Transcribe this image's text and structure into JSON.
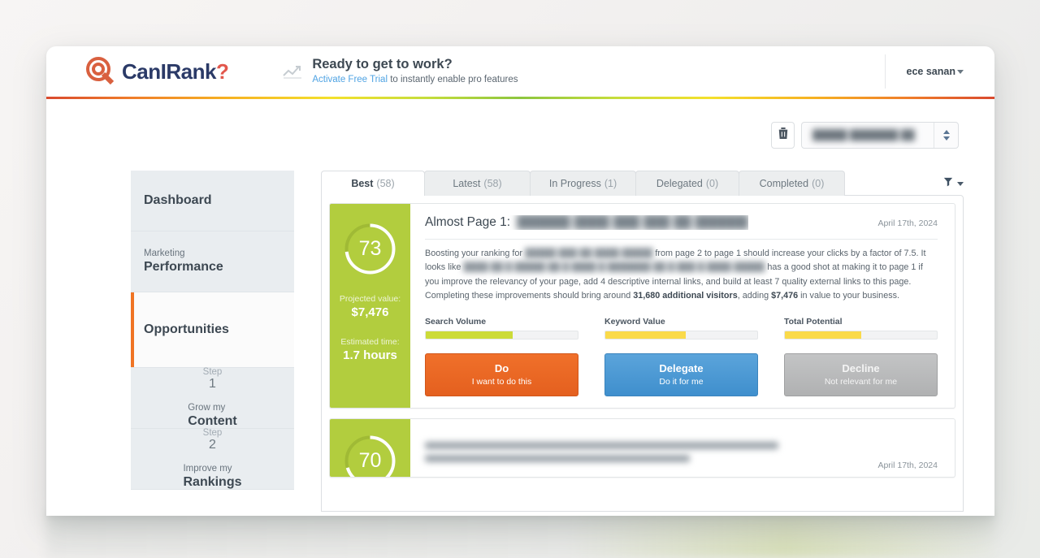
{
  "header": {
    "logo_text_1": "Can",
    "logo_text_2": "I",
    "logo_text_3": "Rank",
    "logo_text_4": "?",
    "logo_icon": "magnifier-logo-icon",
    "promo_icon": "trend-chart-icon",
    "promo_title": "Ready to get to work?",
    "promo_link": "Activate Free Trial",
    "promo_rest": " to instantly enable pro features",
    "user_name": "ece sanan",
    "user_caret_icon": "chevron-down-icon"
  },
  "toolbar": {
    "trash_icon": "trash-icon",
    "select_value": "█████ ███████ ██",
    "select_arrows_icon": "up-down-arrows-icon"
  },
  "sidebar": {
    "items": [
      {
        "kicker": "",
        "title": "Dashboard",
        "step": "",
        "step_num": ""
      },
      {
        "kicker": "Marketing",
        "title": "Performance",
        "step": "",
        "step_num": ""
      },
      {
        "kicker": "",
        "title": "Opportunities",
        "step": "",
        "step_num": ""
      },
      {
        "kicker": "Grow my",
        "title": "Content",
        "step": "Step",
        "step_num": "1"
      },
      {
        "kicker": "Improve my",
        "title": "Rankings",
        "step": "Step",
        "step_num": "2"
      }
    ]
  },
  "tabs": [
    {
      "label": "Best",
      "count": "(58)"
    },
    {
      "label": "Latest",
      "count": "(58)"
    },
    {
      "label": "In Progress",
      "count": "(1)"
    },
    {
      "label": "Delegated",
      "count": "(0)"
    },
    {
      "label": "Completed",
      "count": "(0)"
    }
  ],
  "filter": {
    "icon": "funnel-filter-icon",
    "caret_icon": "chevron-down-icon"
  },
  "card1": {
    "score": "73",
    "score_percent": 73,
    "projected_label": "Projected value:",
    "projected_value": "$7,476",
    "time_label": "Estimated time:",
    "time_value": "1.7 hours",
    "title_prefix": "Almost Page 1:",
    "title_redacted": "██████ ████ ███ ███ ██ ██████",
    "date": "April 17th, 2024",
    "text_1": "Boosting your ranking for ",
    "text_redact_1": "█████ ███ ██ ████ █████",
    "text_2": " from page 2 to page 1 should increase your clicks by a factor of 7.5. It looks like ",
    "text_redact_2": "████ ██ █ █████ ██ █ ████ █ ███████ ██ █ ███ █ ████ █████",
    "text_3": " has a good shot at making it to page 1 if you improve the relevancy of your page, add 4 descriptive internal links, and build at least 7 quality external links to this page. Completing these improvements should bring around ",
    "text_bold_1": "31,680 additional visitors",
    "text_4": ", adding ",
    "text_bold_2": "$7,476",
    "text_5": " in value to your business.",
    "bars": [
      {
        "label": "Search Volume",
        "percent": 57,
        "color": "#ccdb38"
      },
      {
        "label": "Keyword Value",
        "percent": 53,
        "color": "#fada4a"
      },
      {
        "label": "Total Potential",
        "percent": 50,
        "color": "#fada4a"
      }
    ],
    "actions": [
      {
        "title": "Do",
        "sub": "I want to do this",
        "color": "#f0702a"
      },
      {
        "title": "Delegate",
        "sub": "Do it for me",
        "color": "#4f9bd4"
      },
      {
        "title": "Decline",
        "sub": "Not relevant for me",
        "color": "#bbbcbd"
      }
    ]
  },
  "card2": {
    "score": "70",
    "score_percent": 70,
    "date": "April 17th, 2024"
  }
}
